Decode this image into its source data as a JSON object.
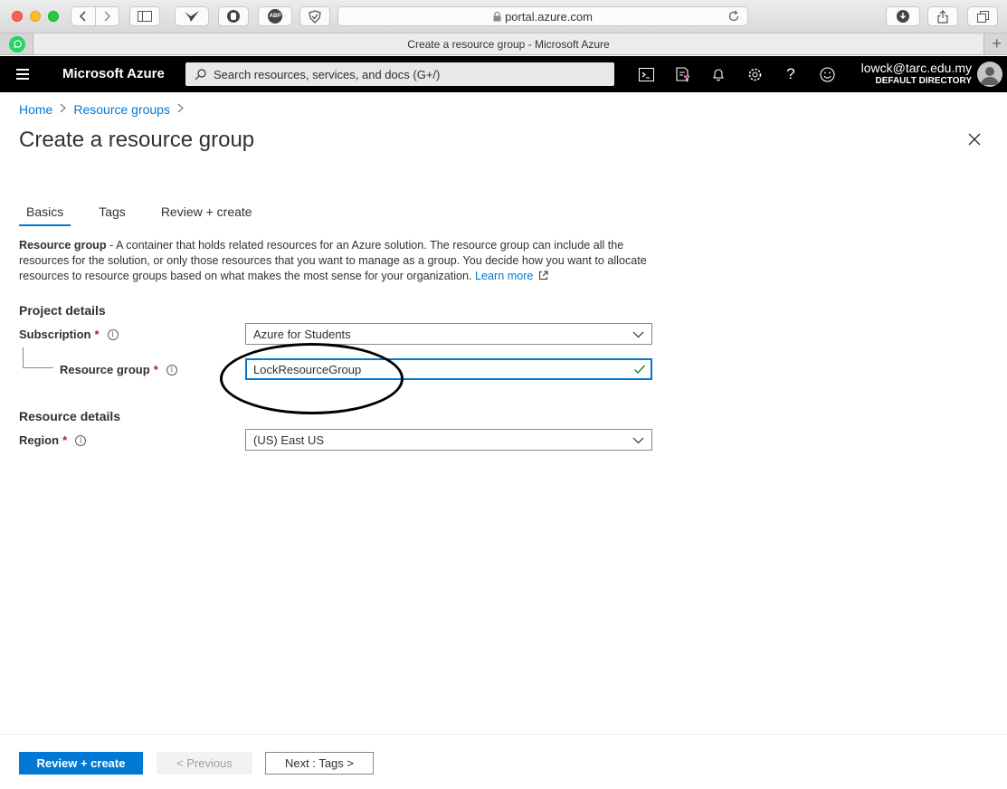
{
  "browser": {
    "url": "portal.azure.com",
    "tab_title": "Create a resource group - Microsoft Azure",
    "adblock_label": "ABP"
  },
  "header": {
    "brand": "Microsoft Azure",
    "search_placeholder": "Search resources, services, and docs (G+/)",
    "account_email": "lowck@tarc.edu.my",
    "account_directory": "DEFAULT DIRECTORY"
  },
  "breadcrumb": {
    "home": "Home",
    "resource_groups": "Resource groups"
  },
  "page": {
    "title": "Create a resource group",
    "tabs": [
      {
        "label": "Basics",
        "active": true
      },
      {
        "label": "Tags",
        "active": false
      },
      {
        "label": "Review + create",
        "active": false
      }
    ],
    "description_bold": "Resource group",
    "description_text": " - A container that holds related resources for an Azure solution. The resource group can include all the resources for the solution, or only those resources that you want to manage as a group. You decide how you want to allocate resources to resource groups based on what makes the most sense for your organization. ",
    "learn_more": "Learn more"
  },
  "project_details": {
    "heading": "Project details",
    "subscription_label": "Subscription",
    "subscription_value": "Azure for Students",
    "resource_group_label": "Resource group",
    "resource_group_value": "LockResourceGroup"
  },
  "resource_details": {
    "heading": "Resource details",
    "region_label": "Region",
    "region_value": "(US) East US"
  },
  "required_marker": "*",
  "info_glyph": "i",
  "footer": {
    "review_create": "Review + create",
    "previous": "< Previous",
    "next": "Next : Tags >"
  },
  "colors": {
    "accent": "#0078d4",
    "header_bg": "#000000",
    "required": "#a4262c",
    "valid": "#107c10"
  }
}
